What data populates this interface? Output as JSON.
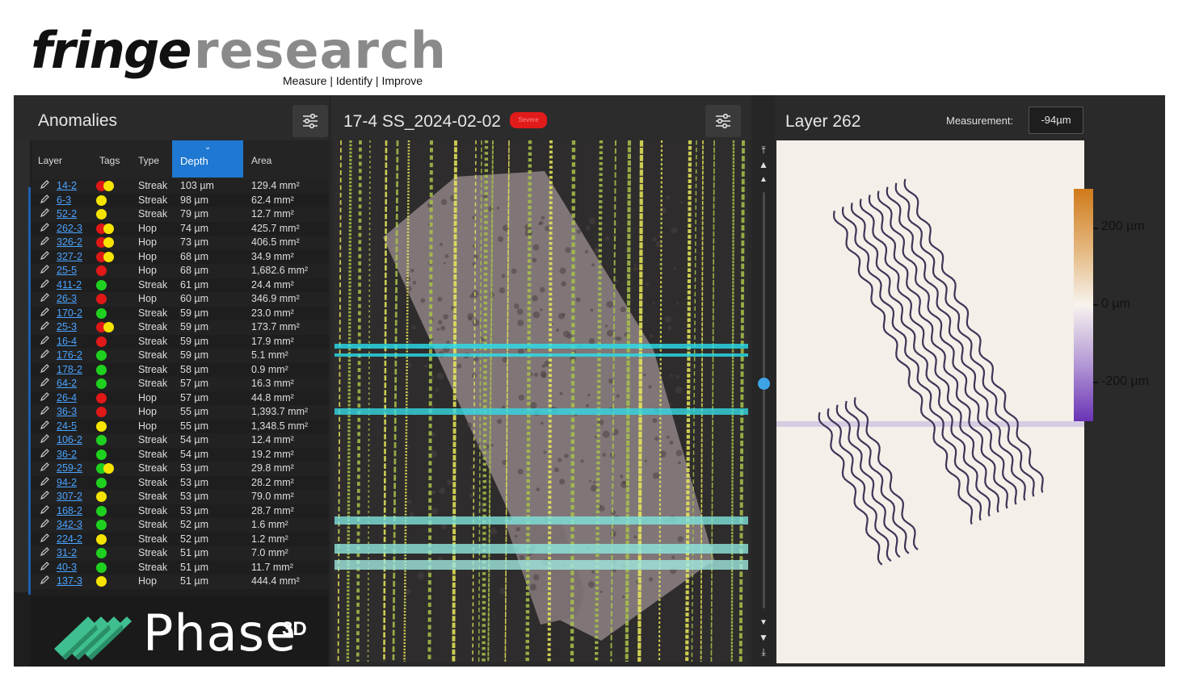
{
  "brand": {
    "name_part1": "fringe",
    "name_part2": "research",
    "tagline": "Measure | Identify | Improve"
  },
  "anomalies": {
    "title": "Anomalies",
    "columns": {
      "layer": "Layer",
      "tags": "Tags",
      "type": "Type",
      "depth": "Depth",
      "area": "Area"
    },
    "sort_column": "Depth",
    "rows": [
      {
        "layer": "14-2",
        "tags": [
          "red",
          "yellow"
        ],
        "type": "Streak",
        "depth": "103 µm",
        "area": "129.4 mm²"
      },
      {
        "layer": "6-3",
        "tags": [
          "yellow"
        ],
        "type": "Streak",
        "depth": "98 µm",
        "area": "62.4 mm²"
      },
      {
        "layer": "52-2",
        "tags": [
          "yellow"
        ],
        "type": "Streak",
        "depth": "79 µm",
        "area": "12.7 mm²"
      },
      {
        "layer": "262-3",
        "tags": [
          "red",
          "yellow"
        ],
        "type": "Hop",
        "depth": "74 µm",
        "area": "425.7 mm²"
      },
      {
        "layer": "326-2",
        "tags": [
          "red",
          "yellow"
        ],
        "type": "Hop",
        "depth": "73 µm",
        "area": "406.5 mm²"
      },
      {
        "layer": "327-2",
        "tags": [
          "red",
          "yellow"
        ],
        "type": "Hop",
        "depth": "68 µm",
        "area": "34.9 mm²"
      },
      {
        "layer": "25-5",
        "tags": [
          "red"
        ],
        "type": "Hop",
        "depth": "68 µm",
        "area": "1,682.6 mm²"
      },
      {
        "layer": "411-2",
        "tags": [
          "green"
        ],
        "type": "Streak",
        "depth": "61 µm",
        "area": "24.4 mm²"
      },
      {
        "layer": "26-3",
        "tags": [
          "red"
        ],
        "type": "Hop",
        "depth": "60 µm",
        "area": "346.9 mm²"
      },
      {
        "layer": "170-2",
        "tags": [
          "green"
        ],
        "type": "Streak",
        "depth": "59 µm",
        "area": "23.0 mm²"
      },
      {
        "layer": "25-3",
        "tags": [
          "red",
          "yellow"
        ],
        "type": "Streak",
        "depth": "59 µm",
        "area": "173.7 mm²"
      },
      {
        "layer": "16-4",
        "tags": [
          "red"
        ],
        "type": "Streak",
        "depth": "59 µm",
        "area": "17.9 mm²"
      },
      {
        "layer": "176-2",
        "tags": [
          "green"
        ],
        "type": "Streak",
        "depth": "59 µm",
        "area": "5.1 mm²"
      },
      {
        "layer": "178-2",
        "tags": [
          "green"
        ],
        "type": "Streak",
        "depth": "58 µm",
        "area": "0.9 mm²"
      },
      {
        "layer": "64-2",
        "tags": [
          "green"
        ],
        "type": "Streak",
        "depth": "57 µm",
        "area": "16.3 mm²"
      },
      {
        "layer": "26-4",
        "tags": [
          "red"
        ],
        "type": "Hop",
        "depth": "57 µm",
        "area": "44.8 mm²"
      },
      {
        "layer": "36-3",
        "tags": [
          "red"
        ],
        "type": "Hop",
        "depth": "55 µm",
        "area": "1,393.7 mm²"
      },
      {
        "layer": "24-5",
        "tags": [
          "yellow"
        ],
        "type": "Hop",
        "depth": "55 µm",
        "area": "1,348.5 mm²"
      },
      {
        "layer": "106-2",
        "tags": [
          "green"
        ],
        "type": "Streak",
        "depth": "54 µm",
        "area": "12.4 mm²"
      },
      {
        "layer": "36-2",
        "tags": [
          "green"
        ],
        "type": "Streak",
        "depth": "54 µm",
        "area": "19.2 mm²"
      },
      {
        "layer": "259-2",
        "tags": [
          "green",
          "yellow"
        ],
        "type": "Streak",
        "depth": "53 µm",
        "area": "29.8 mm²"
      },
      {
        "layer": "94-2",
        "tags": [
          "green"
        ],
        "type": "Streak",
        "depth": "53 µm",
        "area": "28.2 mm²"
      },
      {
        "layer": "307-2",
        "tags": [
          "yellow"
        ],
        "type": "Streak",
        "depth": "53 µm",
        "area": "79.0 mm²"
      },
      {
        "layer": "168-2",
        "tags": [
          "green"
        ],
        "type": "Streak",
        "depth": "53 µm",
        "area": "28.7 mm²"
      },
      {
        "layer": "342-3",
        "tags": [
          "green"
        ],
        "type": "Streak",
        "depth": "52 µm",
        "area": "1.6 mm²"
      },
      {
        "layer": "224-2",
        "tags": [
          "yellow"
        ],
        "type": "Streak",
        "depth": "52 µm",
        "area": "1.2 mm²"
      },
      {
        "layer": "31-2",
        "tags": [
          "green"
        ],
        "type": "Streak",
        "depth": "51 µm",
        "area": "7.0 mm²"
      },
      {
        "layer": "40-3",
        "tags": [
          "green"
        ],
        "type": "Streak",
        "depth": "51 µm",
        "area": "11.7 mm²"
      },
      {
        "layer": "137-3",
        "tags": [
          "yellow"
        ],
        "type": "Hop",
        "depth": "51 µm",
        "area": "444.4 mm²"
      }
    ]
  },
  "tag_colors": {
    "red": "#e01818",
    "yellow": "#f5e400",
    "green": "#1fd11f"
  },
  "phase3d": {
    "name": "Phase",
    "sup": "3D"
  },
  "viewer": {
    "title": "17-4 SS_2024-02-02",
    "severity_badge": "Severe"
  },
  "slider": {
    "value": 0.46
  },
  "layer_view": {
    "title": "Layer 262",
    "measurement_label": "Measurement:",
    "measurement_value": "-94µm"
  },
  "colorbar": {
    "labels": [
      "200 µm",
      "0 µm",
      "-200 µm"
    ],
    "colors": [
      "#d07a1a",
      "#f7f3ee",
      "#6a33b5"
    ]
  }
}
